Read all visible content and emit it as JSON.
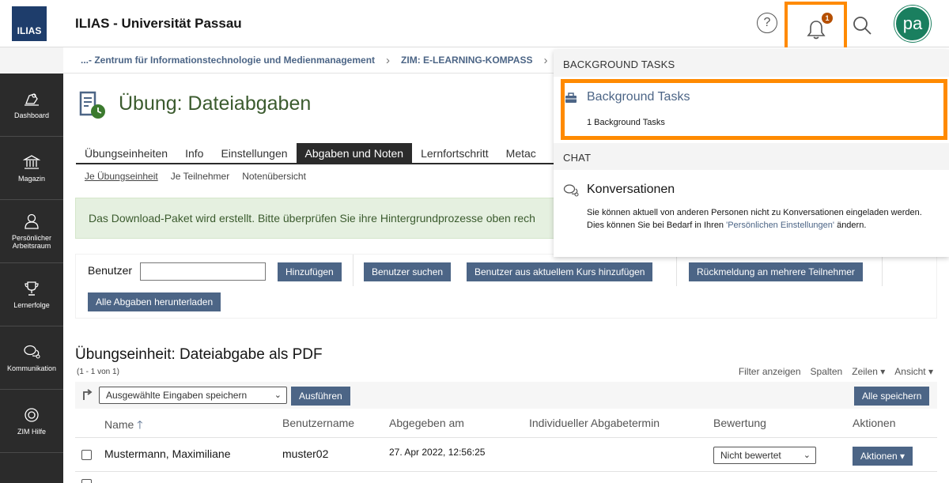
{
  "header": {
    "logo_text": "ILIAS",
    "title": "ILIAS - Universität Passau",
    "help_glyph": "?",
    "notification_count": "1",
    "avatar_initials": "pa",
    "highlight_color": "#ff8a00"
  },
  "breadcrumb": {
    "items": [
      "...- Zentrum für Informationstechnologie und Medienmanagement",
      "ZIM: E-LEARNING-KOMPASS"
    ]
  },
  "sidebar": {
    "items": [
      {
        "label": "Dashboard",
        "icon": "dashboard-icon"
      },
      {
        "label": "Magazin",
        "icon": "library-icon"
      },
      {
        "label": "Persönlicher Arbeitsraum",
        "icon": "user-icon"
      },
      {
        "label": "Lernerfolge",
        "icon": "trophy-icon"
      },
      {
        "label": "Kommunikation",
        "icon": "chat-icon"
      },
      {
        "label": "ZIM Hilfe",
        "icon": "lifebuoy-icon"
      }
    ]
  },
  "page": {
    "title": "Übung: Dateiabgaben",
    "tabs": [
      "Übungseinheiten",
      "Info",
      "Einstellungen",
      "Abgaben und Noten",
      "Lernfortschritt",
      "Metac"
    ],
    "active_tab": "Abgaben und Noten",
    "subtabs": [
      "Je Übungseinheit",
      "Je Teilnehmer",
      "Notenübersicht"
    ],
    "message": "Das Download-Paket wird erstellt. Bitte überprüfen Sie ihre Hintergrundprozesse oben rech"
  },
  "toolbar": {
    "user_label": "Benutzer",
    "user_value": "",
    "add_label": "Hinzufügen",
    "search_users_label": "Benutzer suchen",
    "add_from_course_label": "Benutzer aus aktuellem Kurs hinzufügen",
    "feedback_label": "Rückmeldung an mehrere Teilnehmer",
    "download_all_label": "Alle Abgaben herunterladen"
  },
  "table": {
    "title": "Übungseinheit: Dateiabgabe als PDF",
    "count": "(1 - 1 von 1)",
    "links": [
      "Filter anzeigen",
      "Spalten",
      "Zeilen ▾",
      "Ansicht ▾"
    ],
    "bulk_select": "Ausgewählte Eingaben speichern",
    "execute_label": "Ausführen",
    "save_all_label": "Alle speichern",
    "columns": [
      "Name",
      "Benutzername",
      "Abgegeben am",
      "Individueller Abgabetermin",
      "Bewertung",
      "Aktionen"
    ],
    "sort_indicator": "🡑",
    "rows": [
      {
        "name": "Mustermann, Maximiliane",
        "username": "muster02",
        "submitted": "27. Apr 2022, 12:56:25",
        "deadline": "",
        "grade": "Nicht bewertet",
        "actions": "Aktionen ▾"
      }
    ]
  },
  "notifications": {
    "background_tasks_header": "BACKGROUND TASKS",
    "background_tasks_title": "Background Tasks",
    "background_tasks_sub": "1 Background Tasks",
    "chat_header": "CHAT",
    "chat_title": "Konversationen",
    "chat_text_1": "Sie können aktuell von anderen Personen nicht zu Konversationen eingeladen werden. Dies können Sie bei Bedarf in Ihren ",
    "chat_link": "'Persönlichen Einstellungen'",
    "chat_text_2": " ändern."
  }
}
